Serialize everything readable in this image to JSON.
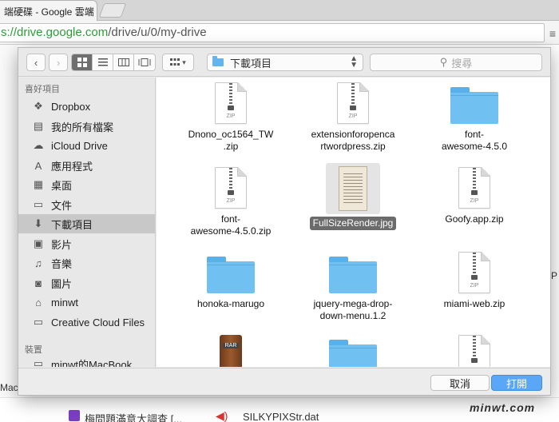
{
  "browser": {
    "tab_title": "端硬碟 - Google 雲端",
    "tab_close": "×",
    "url_host": "s://drive.google.com",
    "url_path": "/drive/u/0/my-drive",
    "menu_icon": "hamburger-icon"
  },
  "background": {
    "partial_text": "Mac",
    "right_partial": "P",
    "bottom_files": [
      "梅問題滿意大調查 [...",
      "SILKYPIXStr.dat"
    ],
    "watermark": "minwt.com"
  },
  "dialog": {
    "toolbar": {
      "back_icon": "‹",
      "forward_icon": "›",
      "views": [
        "icon",
        "list",
        "column",
        "coverflow"
      ],
      "arrange_label": "▾",
      "location": "下載項目",
      "search_placeholder": "搜尋"
    },
    "sidebar": {
      "favorites_header": "喜好項目",
      "items": [
        {
          "label": "Dropbox",
          "icon": "dropbox-icon"
        },
        {
          "label": "我的所有檔案",
          "icon": "all-files-icon"
        },
        {
          "label": "iCloud Drive",
          "icon": "cloud-icon"
        },
        {
          "label": "應用程式",
          "icon": "applications-icon"
        },
        {
          "label": "桌面",
          "icon": "desktop-icon"
        },
        {
          "label": "文件",
          "icon": "documents-icon"
        },
        {
          "label": "下載項目",
          "icon": "downloads-icon",
          "selected": true
        },
        {
          "label": "影片",
          "icon": "movies-icon"
        },
        {
          "label": "音樂",
          "icon": "music-icon"
        },
        {
          "label": "圖片",
          "icon": "pictures-icon"
        },
        {
          "label": "minwt",
          "icon": "home-icon"
        },
        {
          "label": "Creative Cloud Files",
          "icon": "folder-icon"
        }
      ],
      "devices_header": "裝置",
      "devices": [
        {
          "label": "minwt的MacBook",
          "icon": "laptop-icon"
        }
      ]
    },
    "files": [
      {
        "name": "Dnono_oc1564_TW\n.zip",
        "kind": "zip"
      },
      {
        "name": "extensionforopenca\nrtwordpress.zip",
        "kind": "zip"
      },
      {
        "name": "font-\nawesome-4.5.0",
        "kind": "folder"
      },
      {
        "name": "font-\nawesome-4.5.0.zip",
        "kind": "zip"
      },
      {
        "name": "FullSizeRender.jpg",
        "kind": "image",
        "selected": true
      },
      {
        "name": "Goofy.app.zip",
        "kind": "zip"
      },
      {
        "name": "honoka-marugo",
        "kind": "folder"
      },
      {
        "name": "jquery-mega-drop-\ndown-menu.1.2",
        "kind": "folder"
      },
      {
        "name": "miami-web.zip",
        "kind": "zip"
      },
      {
        "name": "",
        "kind": "rar"
      },
      {
        "name": "",
        "kind": "folder"
      },
      {
        "name": "",
        "kind": "zip"
      }
    ],
    "zip_ext": "ZIP",
    "rar_ext": "RAR",
    "footer": {
      "cancel": "取消",
      "open": "打開"
    }
  }
}
